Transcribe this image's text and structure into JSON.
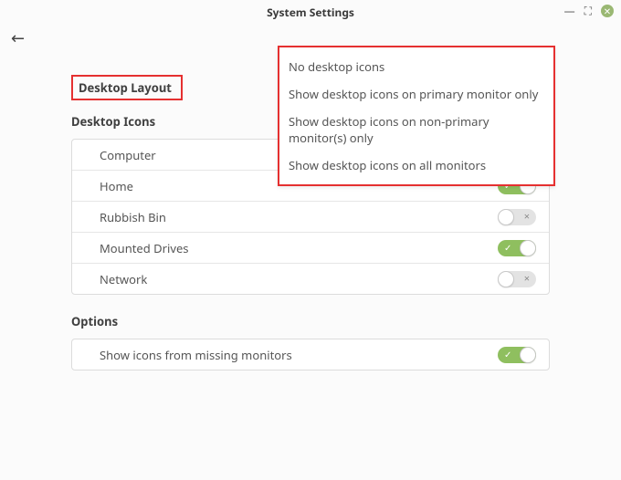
{
  "window": {
    "title": "System Settings"
  },
  "headings": {
    "layout": "Desktop Layout",
    "icons": "Desktop Icons",
    "options": "Options"
  },
  "dropdown": {
    "options": [
      "No desktop icons",
      "Show desktop icons on primary monitor only",
      "Show desktop icons on non-primary monitor(s) only",
      "Show desktop icons on all monitors"
    ]
  },
  "icons_rows": [
    {
      "label": "Computer",
      "state": null
    },
    {
      "label": "Home",
      "state": true
    },
    {
      "label": "Rubbish Bin",
      "state": false
    },
    {
      "label": "Mounted Drives",
      "state": true
    },
    {
      "label": "Network",
      "state": false
    }
  ],
  "options_rows": [
    {
      "label": "Show icons from missing monitors",
      "state": true
    }
  ]
}
